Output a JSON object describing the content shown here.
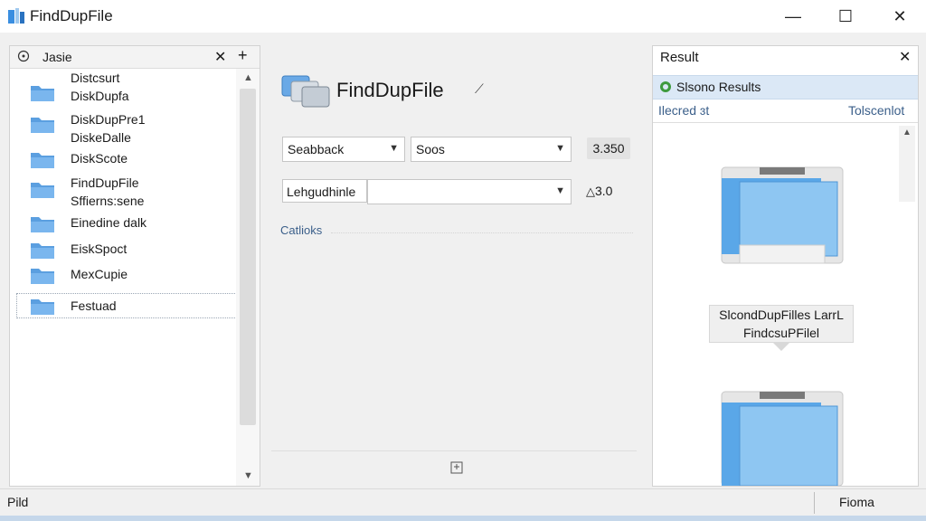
{
  "window": {
    "title": "FindDupFile",
    "minimize_glyph": "—",
    "maximize_glyph": "☐",
    "close_glyph": "✕"
  },
  "left_panel": {
    "header_label": "Jasie",
    "close_glyph": "✕",
    "add_glyph": "+",
    "items": [
      {
        "lines": [
          "Distcsurt",
          "DiskDupfa"
        ]
      },
      {
        "lines": [
          "DiskDupPre1",
          "DiskeDalle"
        ]
      },
      {
        "lines": [
          "DiskScote"
        ]
      },
      {
        "lines": [
          "FindDupFile",
          "Sffierns:sene"
        ]
      },
      {
        "lines": [
          "Einedine dalk"
        ]
      },
      {
        "lines": [
          "EiskSpoct"
        ]
      },
      {
        "lines": [
          "MexCupie"
        ]
      },
      {
        "lines": [
          "Festuad"
        ],
        "selected": true
      }
    ],
    "scroll_up": "▲",
    "scroll_down": "▼"
  },
  "center": {
    "heading": "FindDupFile",
    "combo1": "Seabback",
    "combo2": "Soos",
    "number_value": "3.350",
    "label_box": "Lehgudhinle",
    "combo3": "",
    "number_value2": "3.0",
    "category_link": "Catlioks"
  },
  "right_panel": {
    "title": "Result",
    "close_glyph": "✕",
    "band_label": "Slsono Results",
    "col_left": "Ilecred ɜt",
    "col_right": "Tolscenlot",
    "scroll_up": "▲",
    "tooltip_line1": "SlcondDupFilles LarrL",
    "tooltip_line2": "FindcsuPFilel"
  },
  "status": {
    "left": "Pild",
    "right": "Fioma"
  },
  "colors": {
    "accent_blue": "#4a90d9",
    "band_bg": "#dbe8f6",
    "link": "#3b5f8a"
  }
}
